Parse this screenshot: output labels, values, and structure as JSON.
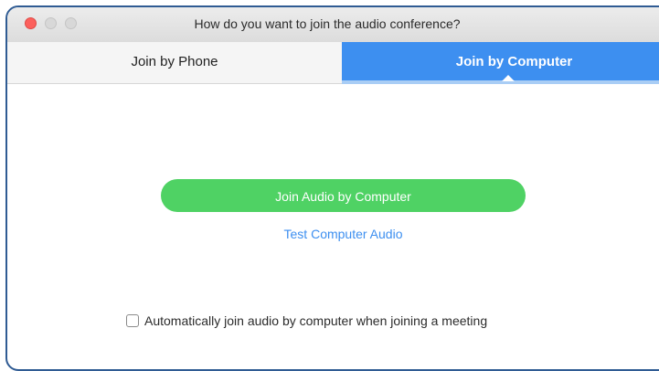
{
  "window": {
    "title": "How do you want to join the audio conference?"
  },
  "tabs": [
    {
      "label": "Join by Phone",
      "selected": false
    },
    {
      "label": "Join by Computer",
      "selected": true
    }
  ],
  "main": {
    "join_button_label": "Join Audio by Computer",
    "test_link_label": "Test Computer Audio",
    "auto_join_label": "Automatically join audio by computer when joining a meeting",
    "auto_join_checked": false
  },
  "colors": {
    "accent": "#3d8ff0",
    "join_button": "#4fd264",
    "close_button": "#fc605c",
    "window_border": "#2f5b93"
  }
}
